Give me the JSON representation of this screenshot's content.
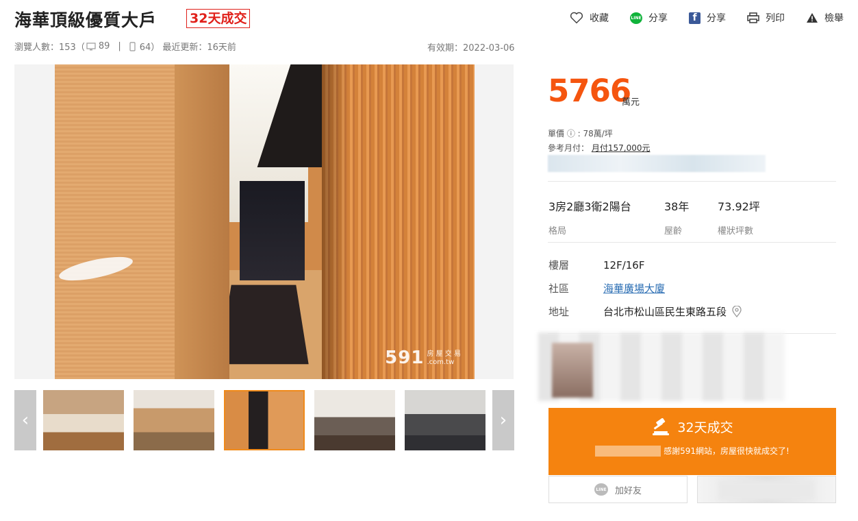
{
  "header": {
    "title": "海華頂級優質大戶",
    "badge": "32天成交",
    "actions": [
      {
        "label": "收藏",
        "icon": "heart-icon"
      },
      {
        "label": "分享",
        "icon": "line-icon"
      },
      {
        "label": "分享",
        "icon": "facebook-icon"
      },
      {
        "label": "列印",
        "icon": "printer-icon"
      },
      {
        "label": "檢舉",
        "icon": "warning-icon"
      }
    ],
    "line_icon_text": "LINE",
    "fb_icon_text": "f"
  },
  "meta": {
    "views": "瀏覽人數：153（",
    "pc_count": "89",
    "sep": "|",
    "mobile_count": "64）",
    "updated": "最近更新：16天前",
    "expire": "有效期：2022-03-06"
  },
  "photo": {
    "watermark_num": "591",
    "watermark_text1": "房 屋 交 易",
    "watermark_text2": ".com.tw"
  },
  "thumbnails": {
    "prev": "‹",
    "next": "›",
    "active_index": 2,
    "count": 5
  },
  "price": {
    "amount": "5766",
    "unit": "萬元",
    "unit_price": "單價 ⓘ : 78萬/坪",
    "monthly_label": "參考月付：",
    "monthly_value": "月付157,000元"
  },
  "specs": [
    {
      "value": "3房2廳3衛2陽台",
      "label": "格局"
    },
    {
      "value": "38年",
      "label": "屋齡"
    },
    {
      "value": "73.92坪",
      "label": "權狀坪數"
    }
  ],
  "details": [
    {
      "label": "樓層",
      "value": "12F/16F"
    },
    {
      "label": "社區",
      "value": "海華廣場大廈"
    },
    {
      "label": "地址",
      "value": "台北市松山區民生東路五段"
    }
  ],
  "deal": {
    "title": "32天成交",
    "subtitle": "感謝591網站，房屋很快就成交了!"
  },
  "line_button": {
    "icon_text": "LINE",
    "label": "加好友"
  },
  "colors": {
    "price": "#f5550f",
    "deal_bg": "#f5830f",
    "badge": "#e0201a",
    "link": "#2a6db3"
  }
}
